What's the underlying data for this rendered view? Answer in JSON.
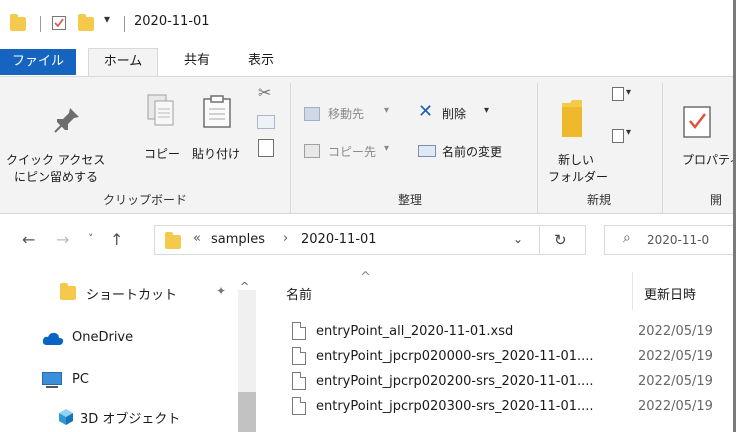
{
  "window": {
    "title": "2020-11-01"
  },
  "tabs": {
    "file": "ファイル",
    "home": "ホーム",
    "share": "共有",
    "view": "表示"
  },
  "ribbon": {
    "pin_line1": "クイック アクセス",
    "pin_line2": "にピン留めする",
    "copy": "コピー",
    "paste": "貼り付け",
    "clipboard_group": "クリップボード",
    "move_to": "移動先",
    "copy_to": "コピー先",
    "delete": "削除",
    "rename": "名前の変更",
    "organize_group": "整理",
    "new_folder_line1": "新しい",
    "new_folder_line2": "フォルダー",
    "new_group": "新規",
    "properties": "プロパティ",
    "open_group": "開"
  },
  "address": {
    "overflow": "«",
    "crumb1": "samples",
    "crumb_sep": "›",
    "crumb2": "2020-11-01",
    "search_placeholder": "2020-11-0"
  },
  "nav": {
    "quick_access": "ショートカット",
    "onedrive": "OneDrive",
    "pc": "PC",
    "objects3d": "3D オブジェクト"
  },
  "list": {
    "col_name": "名前",
    "col_date": "更新日時",
    "files": [
      {
        "name": "entryPoint_all_2020-11-01.xsd",
        "date": "2022/05/19"
      },
      {
        "name": "entryPoint_jpcrp020000-srs_2020-11-01....",
        "date": "2022/05/19"
      },
      {
        "name": "entryPoint_jpcrp020200-srs_2020-11-01....",
        "date": "2022/05/19"
      },
      {
        "name": "entryPoint_jpcrp020300-srs_2020-11-01....",
        "date": "2022/05/19"
      }
    ]
  },
  "colors": {
    "accent": "#1565c0",
    "folder": "#f5c94b",
    "onedrive": "#0a64c8"
  }
}
